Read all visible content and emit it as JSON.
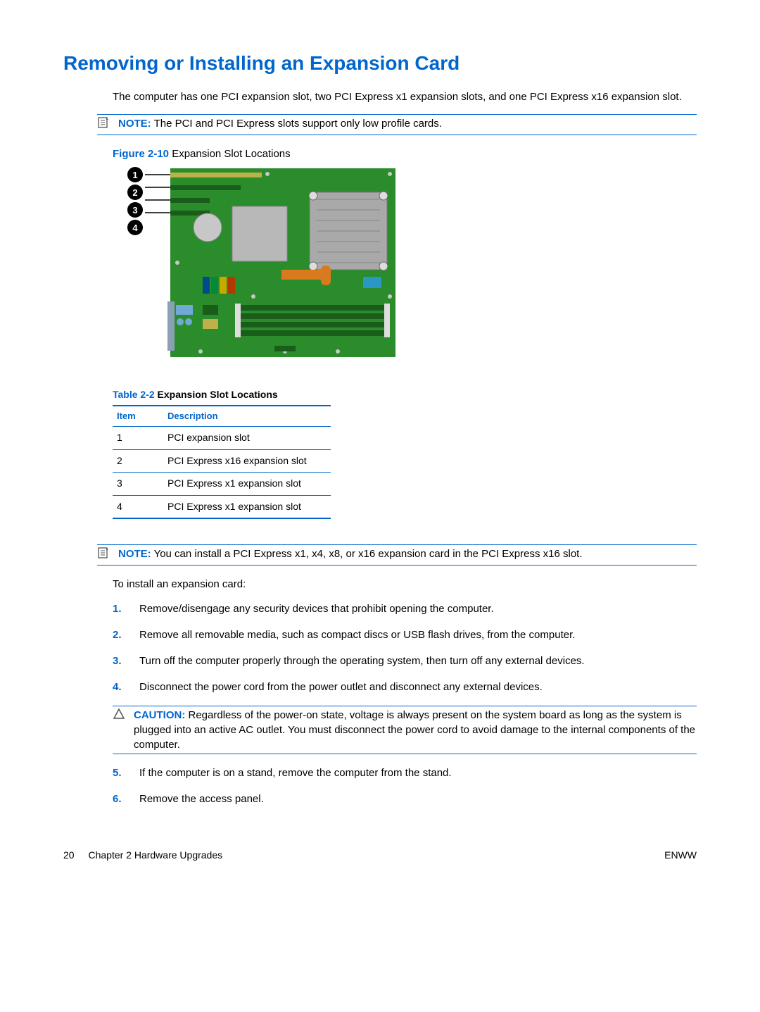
{
  "heading": "Removing or Installing an Expansion Card",
  "intro": "The computer has one PCI expansion slot, two PCI Express x1 expansion slots, and one PCI Express x16 expansion slot.",
  "note1": {
    "label": "NOTE:",
    "text": "The PCI and PCI Express slots support only low profile cards."
  },
  "figure": {
    "label": "Figure 2-10",
    "caption": "Expansion Slot Locations",
    "callouts": [
      "1",
      "2",
      "3",
      "4"
    ]
  },
  "table": {
    "label": "Table 2-2",
    "caption": "Expansion Slot Locations",
    "headers": {
      "item": "Item",
      "desc": "Description"
    },
    "rows": [
      {
        "item": "1",
        "desc": "PCI expansion slot"
      },
      {
        "item": "2",
        "desc": "PCI Express x16 expansion slot"
      },
      {
        "item": "3",
        "desc": "PCI Express x1 expansion slot"
      },
      {
        "item": "4",
        "desc": "PCI Express x1 expansion slot"
      }
    ]
  },
  "note2": {
    "label": "NOTE:",
    "text": "You can install a PCI Express x1, x4, x8, or x16 expansion card in the PCI Express x16 slot."
  },
  "install_lead": "To install an expansion card:",
  "steps": [
    {
      "n": "1.",
      "t": "Remove/disengage any security devices that prohibit opening the computer."
    },
    {
      "n": "2.",
      "t": "Remove all removable media, such as compact discs or USB flash drives, from the computer."
    },
    {
      "n": "3.",
      "t": "Turn off the computer properly through the operating system, then turn off any external devices."
    },
    {
      "n": "4.",
      "t": "Disconnect the power cord from the power outlet and disconnect any external devices."
    },
    {
      "n": "5.",
      "t": "If the computer is on a stand, remove the computer from the stand."
    },
    {
      "n": "6.",
      "t": "Remove the access panel."
    }
  ],
  "caution": {
    "label": "CAUTION:",
    "text": "Regardless of the power-on state, voltage is always present on the system board as long as the system is plugged into an active AC outlet. You must disconnect the power cord to avoid damage to the internal components of the computer."
  },
  "footer": {
    "page": "20",
    "chapter": "Chapter 2   Hardware Upgrades",
    "right": "ENWW"
  }
}
